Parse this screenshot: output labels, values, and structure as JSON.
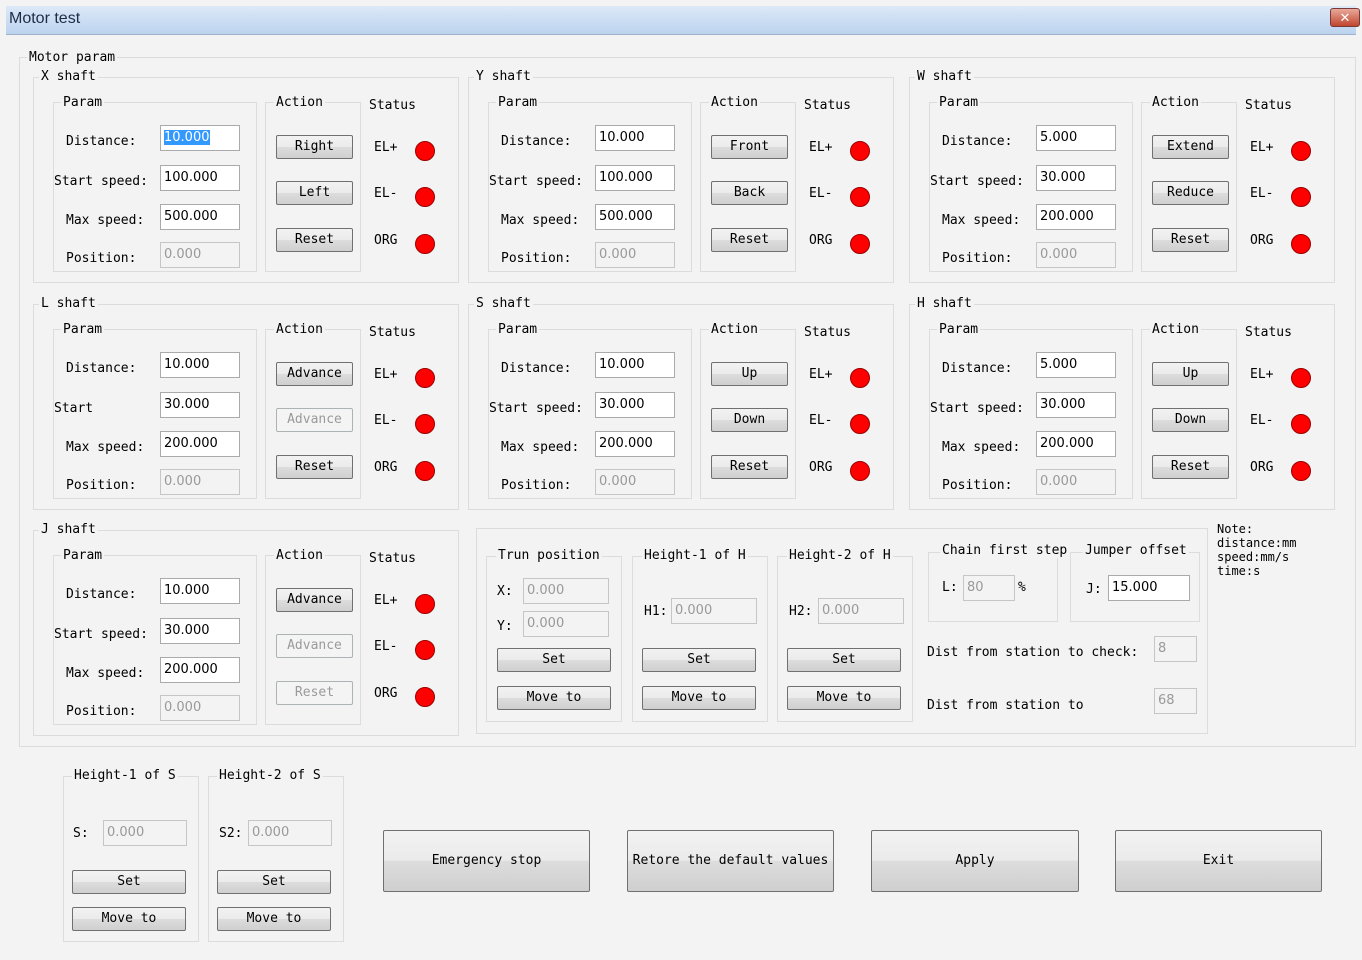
{
  "window": {
    "title": "Motor test",
    "close_glyph": "✕"
  },
  "motor_param_label": "Motor param",
  "headers": {
    "param": "Param",
    "action": "Action",
    "status": "Status"
  },
  "status_labels": {
    "el_plus": "EL+",
    "el_minus": "EL-",
    "org": "ORG"
  },
  "status_color": "#ff0000",
  "x_shaft": {
    "title": "X shaft",
    "labels": [
      "Distance:",
      "Start speed:",
      "Max speed:",
      "Position:"
    ],
    "values": [
      "10.000",
      "100.000",
      "500.000",
      "0.000"
    ],
    "buttons": [
      "Right",
      "Left",
      "Reset"
    ]
  },
  "y_shaft": {
    "title": "Y shaft",
    "labels": [
      "Distance:",
      "Start speed:",
      "Max speed:",
      "Position:"
    ],
    "values": [
      "10.000",
      "100.000",
      "500.000",
      "0.000"
    ],
    "buttons": [
      "Front",
      "Back",
      "Reset"
    ]
  },
  "w_shaft": {
    "title": "W shaft",
    "labels": [
      "Distance:",
      "Start speed:",
      "Max speed:",
      "Position:"
    ],
    "values": [
      "5.000",
      "30.000",
      "200.000",
      "0.000"
    ],
    "buttons": [
      "Extend",
      "Reduce",
      "Reset"
    ]
  },
  "l_shaft": {
    "title": "L shaft",
    "labels": [
      "Distance:",
      "Start",
      "Max speed:",
      "Position:"
    ],
    "values": [
      "10.000",
      "30.000",
      "200.000",
      "0.000"
    ],
    "buttons": [
      "Advance",
      "Advance",
      "Reset"
    ]
  },
  "s_shaft": {
    "title": "S shaft",
    "labels": [
      "Distance:",
      "Start speed:",
      "Max speed:",
      "Position:"
    ],
    "values": [
      "10.000",
      "30.000",
      "200.000",
      "0.000"
    ],
    "buttons": [
      "Up",
      "Down",
      "Reset"
    ]
  },
  "h_shaft": {
    "title": "H shaft",
    "labels": [
      "Distance:",
      "Start speed:",
      "Max speed:",
      "Position:"
    ],
    "values": [
      "5.000",
      "30.000",
      "200.000",
      "0.000"
    ],
    "buttons": [
      "Up",
      "Down",
      "Reset"
    ]
  },
  "j_shaft": {
    "title": "J shaft",
    "labels": [
      "Distance:",
      "Start speed:",
      "Max speed:",
      "Position:"
    ],
    "values": [
      "10.000",
      "30.000",
      "200.000",
      "0.000"
    ],
    "buttons": [
      "Advance",
      "Advance",
      "Reset"
    ]
  },
  "trun_position": {
    "title": "Trun position",
    "x_label": "X:",
    "x_value": "0.000",
    "y_label": "Y:",
    "y_value": "0.000",
    "set": "Set",
    "move_to": "Move to"
  },
  "height1_h": {
    "title": "Height-1 of H",
    "label": "H1:",
    "value": "0.000",
    "set": "Set",
    "move_to": "Move to"
  },
  "height2_h": {
    "title": "Height-2 of H",
    "label": "H2:",
    "value": "0.000",
    "set": "Set",
    "move_to": "Move to"
  },
  "chain_first_step": {
    "title": "Chain first step",
    "label": "L:",
    "value": "80",
    "unit": "%"
  },
  "jumper_offset": {
    "title": "Jumper offset",
    "label": "J:",
    "value": "15.000"
  },
  "dist_check": {
    "label": "Dist from station to check:",
    "value": "8"
  },
  "dist_to": {
    "label": "Dist from station to",
    "value": "68"
  },
  "note": {
    "lines": [
      "Note:",
      "distance:mm",
      "speed:mm/s",
      "time:s"
    ]
  },
  "height1_s": {
    "title": "Height-1 of S",
    "label": "S:",
    "value": "0.000",
    "set": "Set",
    "move_to": "Move to"
  },
  "height2_s": {
    "title": "Height-2 of S",
    "label": "S2:",
    "value": "0.000",
    "set": "Set",
    "move_to": "Move to"
  },
  "bottom_buttons": {
    "emergency": "Emergency stop",
    "restore": "Retore the default values",
    "apply": "Apply",
    "exit": "Exit"
  }
}
